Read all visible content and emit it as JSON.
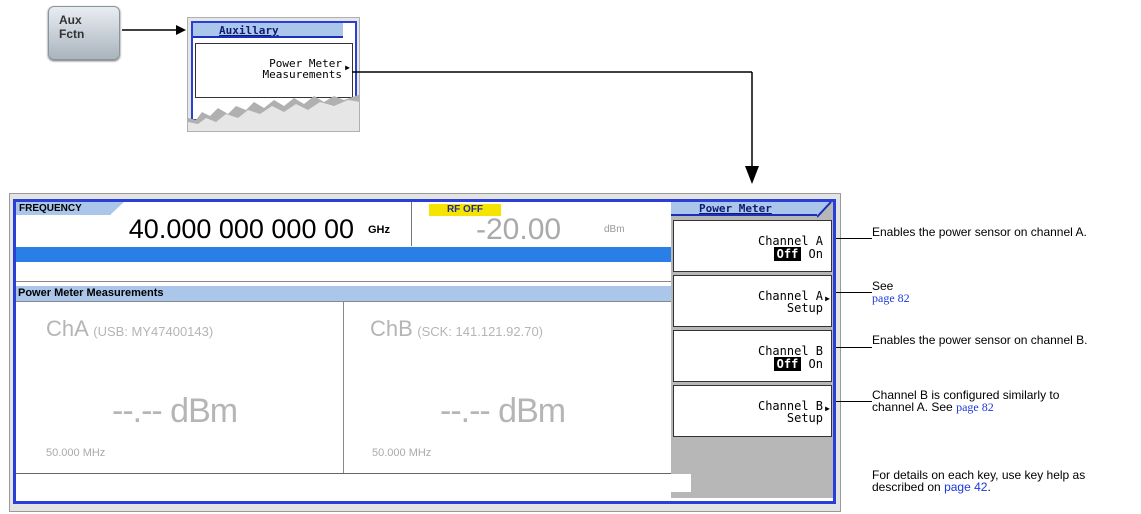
{
  "aux_key": {
    "line1": "Aux",
    "line2": "Fctn"
  },
  "aux_menu": {
    "title": "Auxillary",
    "key_line1": "Power Meter",
    "key_line2": "Measurements"
  },
  "screen": {
    "freq_label": "FREQUENCY",
    "freq_value": "40.000 000 000 00",
    "freq_unit": "GHz",
    "rf_status": "RF OFF",
    "amp_value": "-20.00",
    "amp_unit": "dBm",
    "panel_title": "Power Meter Measurements",
    "channel_a": {
      "name": "ChA",
      "sensor": "(USB: MY47400143)",
      "reading": "--.-- dBm",
      "freq": "50.000 MHz"
    },
    "channel_b": {
      "name": "ChB",
      "sensor": "(SCK: 141.121.92.70)",
      "reading": "--.-- dBm",
      "freq": "50.000 MHz"
    }
  },
  "softkeys": {
    "title": "Power Meter",
    "keys": [
      {
        "line1": "Channel A",
        "off": "Off",
        "on": "On"
      },
      {
        "line1": "Channel A",
        "line2": "Setup"
      },
      {
        "line1": "Channel B",
        "off": "Off",
        "on": "On"
      },
      {
        "line1": "Channel B",
        "line2": "Setup"
      }
    ]
  },
  "annotations": {
    "a1": "Enables the power sensor on channel A.",
    "a2_see": "See",
    "a2_link": "page 82",
    "a3": "Enables the power sensor on channel B.",
    "a4_text": "Channel B is configured similarly to channel A. See",
    "a4_link": "page 82",
    "a5_text": "For details on each key, use key help as described on",
    "a5_link": "page 42",
    "a5_end": "."
  }
}
